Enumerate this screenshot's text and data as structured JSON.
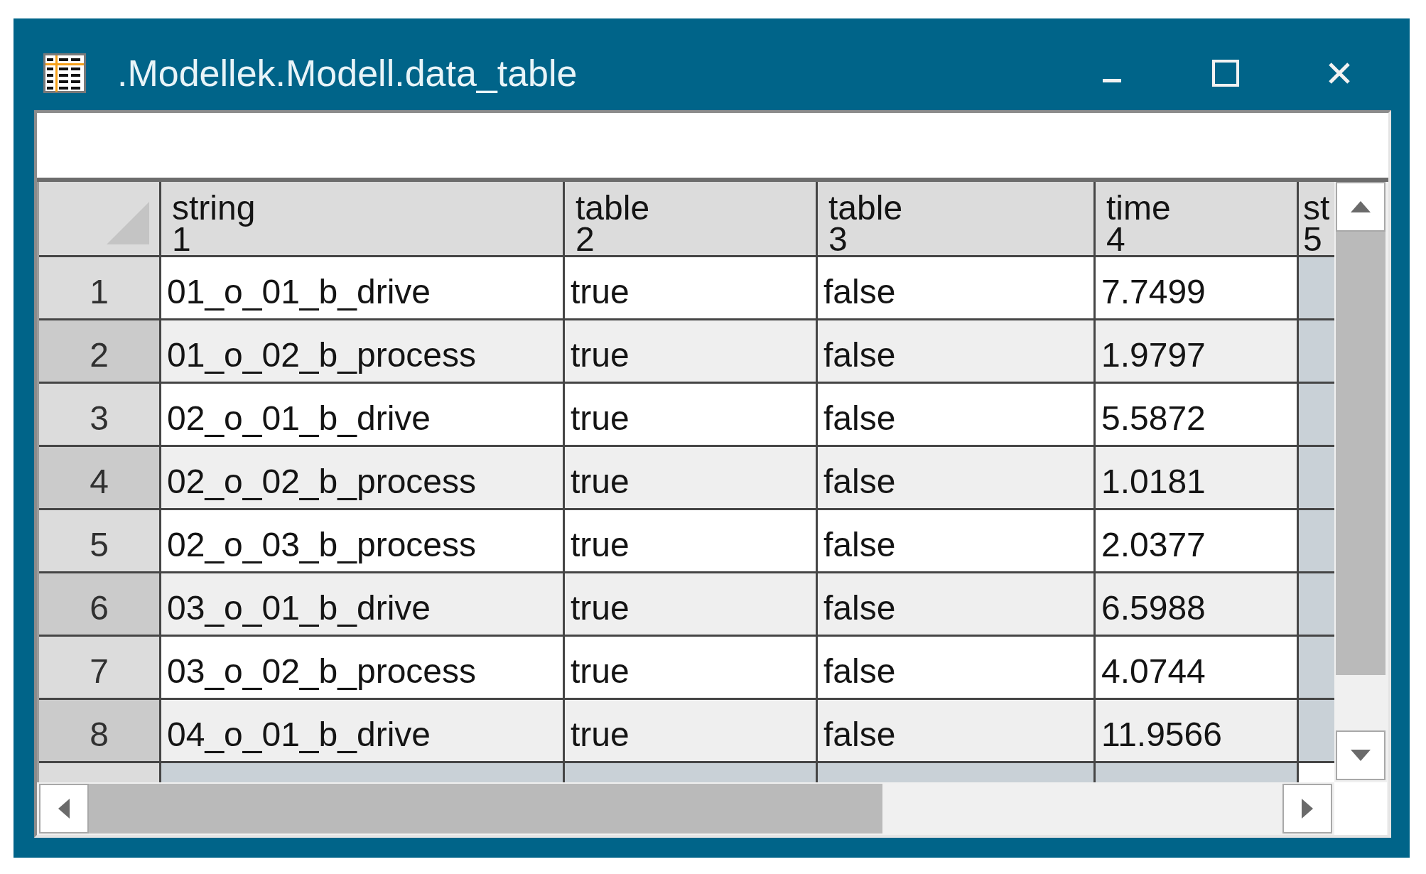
{
  "window": {
    "title": ".Modellek.Modell.data_table"
  },
  "table": {
    "columns": [
      {
        "label": "string",
        "number": "1"
      },
      {
        "label": "table",
        "number": "2"
      },
      {
        "label": "table",
        "number": "3"
      },
      {
        "label": "time",
        "number": "4"
      },
      {
        "label": "st",
        "number": "5"
      }
    ],
    "rows": [
      {
        "number": "1",
        "cells": [
          "01_o_01_b_drive",
          "true",
          "false",
          "7.7499"
        ]
      },
      {
        "number": "2",
        "cells": [
          "01_o_02_b_process",
          "true",
          "false",
          "1.9797"
        ]
      },
      {
        "number": "3",
        "cells": [
          "02_o_01_b_drive",
          "true",
          "false",
          "5.5872"
        ]
      },
      {
        "number": "4",
        "cells": [
          "02_o_02_b_process",
          "true",
          "false",
          "1.0181"
        ]
      },
      {
        "number": "5",
        "cells": [
          "02_o_03_b_process",
          "true",
          "false",
          "2.0377"
        ]
      },
      {
        "number": "6",
        "cells": [
          "03_o_01_b_drive",
          "true",
          "false",
          "6.5988"
        ]
      },
      {
        "number": "7",
        "cells": [
          "03_o_02_b_process",
          "true",
          "false",
          "4.0744"
        ]
      },
      {
        "number": "8",
        "cells": [
          "04_o_01_b_drive",
          "true",
          "false",
          "11.9566"
        ]
      }
    ]
  }
}
